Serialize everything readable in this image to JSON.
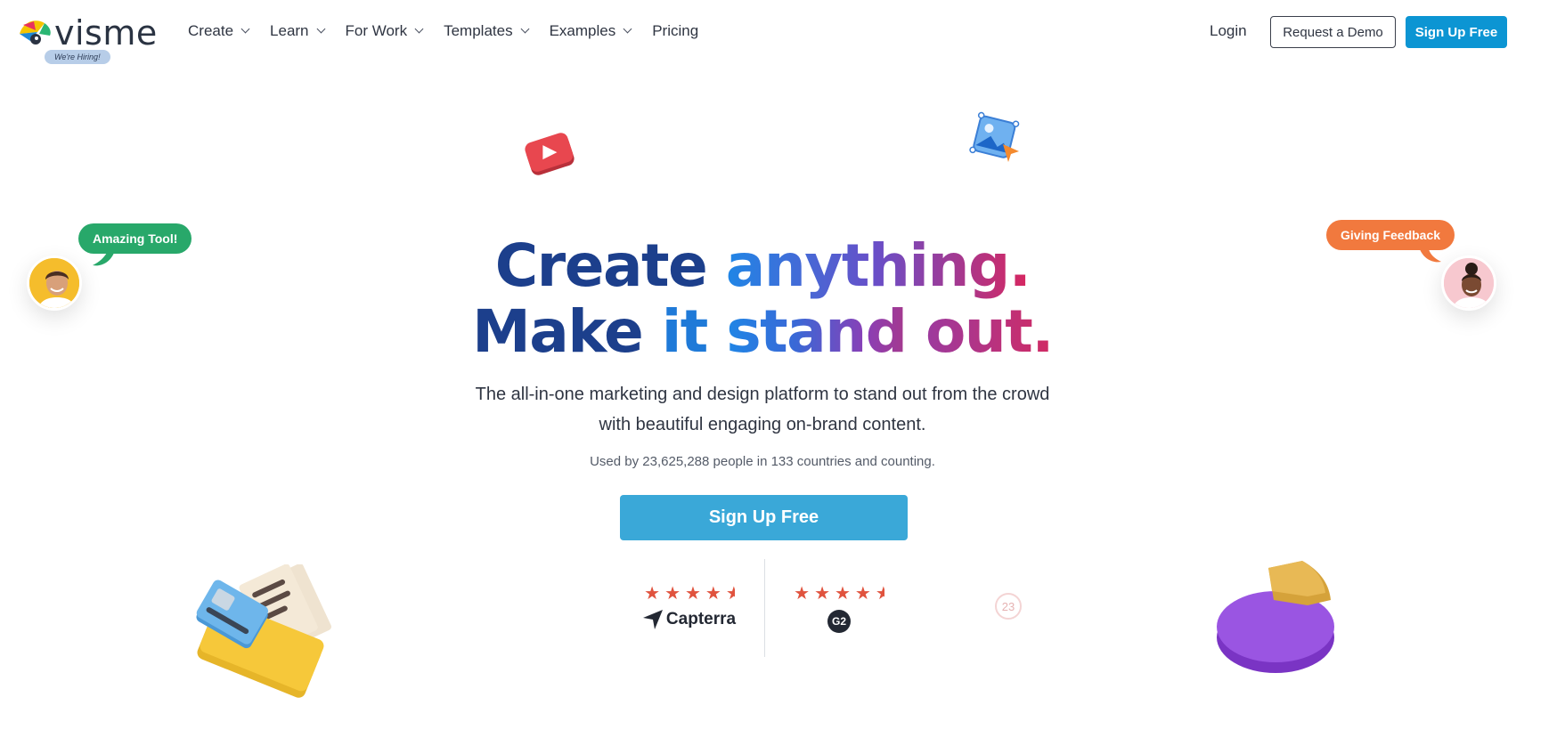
{
  "logo": {
    "text": "visme",
    "hiring_badge": "We're Hiring!"
  },
  "nav": {
    "items": [
      {
        "label": "Create",
        "has_dropdown": true
      },
      {
        "label": "Learn",
        "has_dropdown": true
      },
      {
        "label": "For Work",
        "has_dropdown": true
      },
      {
        "label": "Templates",
        "has_dropdown": true
      },
      {
        "label": "Examples",
        "has_dropdown": true
      },
      {
        "label": "Pricing",
        "has_dropdown": false
      }
    ],
    "login": "Login",
    "request_demo": "Request a Demo",
    "signup": "Sign Up Free"
  },
  "hero": {
    "line1_a": "Create ",
    "line1_b": "anything.",
    "line2_a": "Make ",
    "line2_b": "it ",
    "line2_c": "stand ",
    "line2_d": "out.",
    "subheadline": "The all-in-one marketing and design platform to stand out from the crowd with beautiful engaging on-brand content.",
    "used_by": "Used by 23,625,288 people in 133 countries and counting.",
    "cta": "Sign Up Free"
  },
  "ratings": [
    {
      "brand": "Capterra",
      "stars": 4.5
    },
    {
      "brand": "G2",
      "stars": 4.5
    }
  ],
  "badge": "23",
  "floating": {
    "left_bubble": "Amazing Tool!",
    "right_bubble": "Giving Feedback"
  },
  "colors": {
    "primary": "#0c95d3",
    "cta": "#3aa8d8",
    "navy": "#1c3f8c",
    "green_bubble": "#28a86a",
    "orange_bubble": "#f1793e",
    "stars": "#e0533e"
  }
}
